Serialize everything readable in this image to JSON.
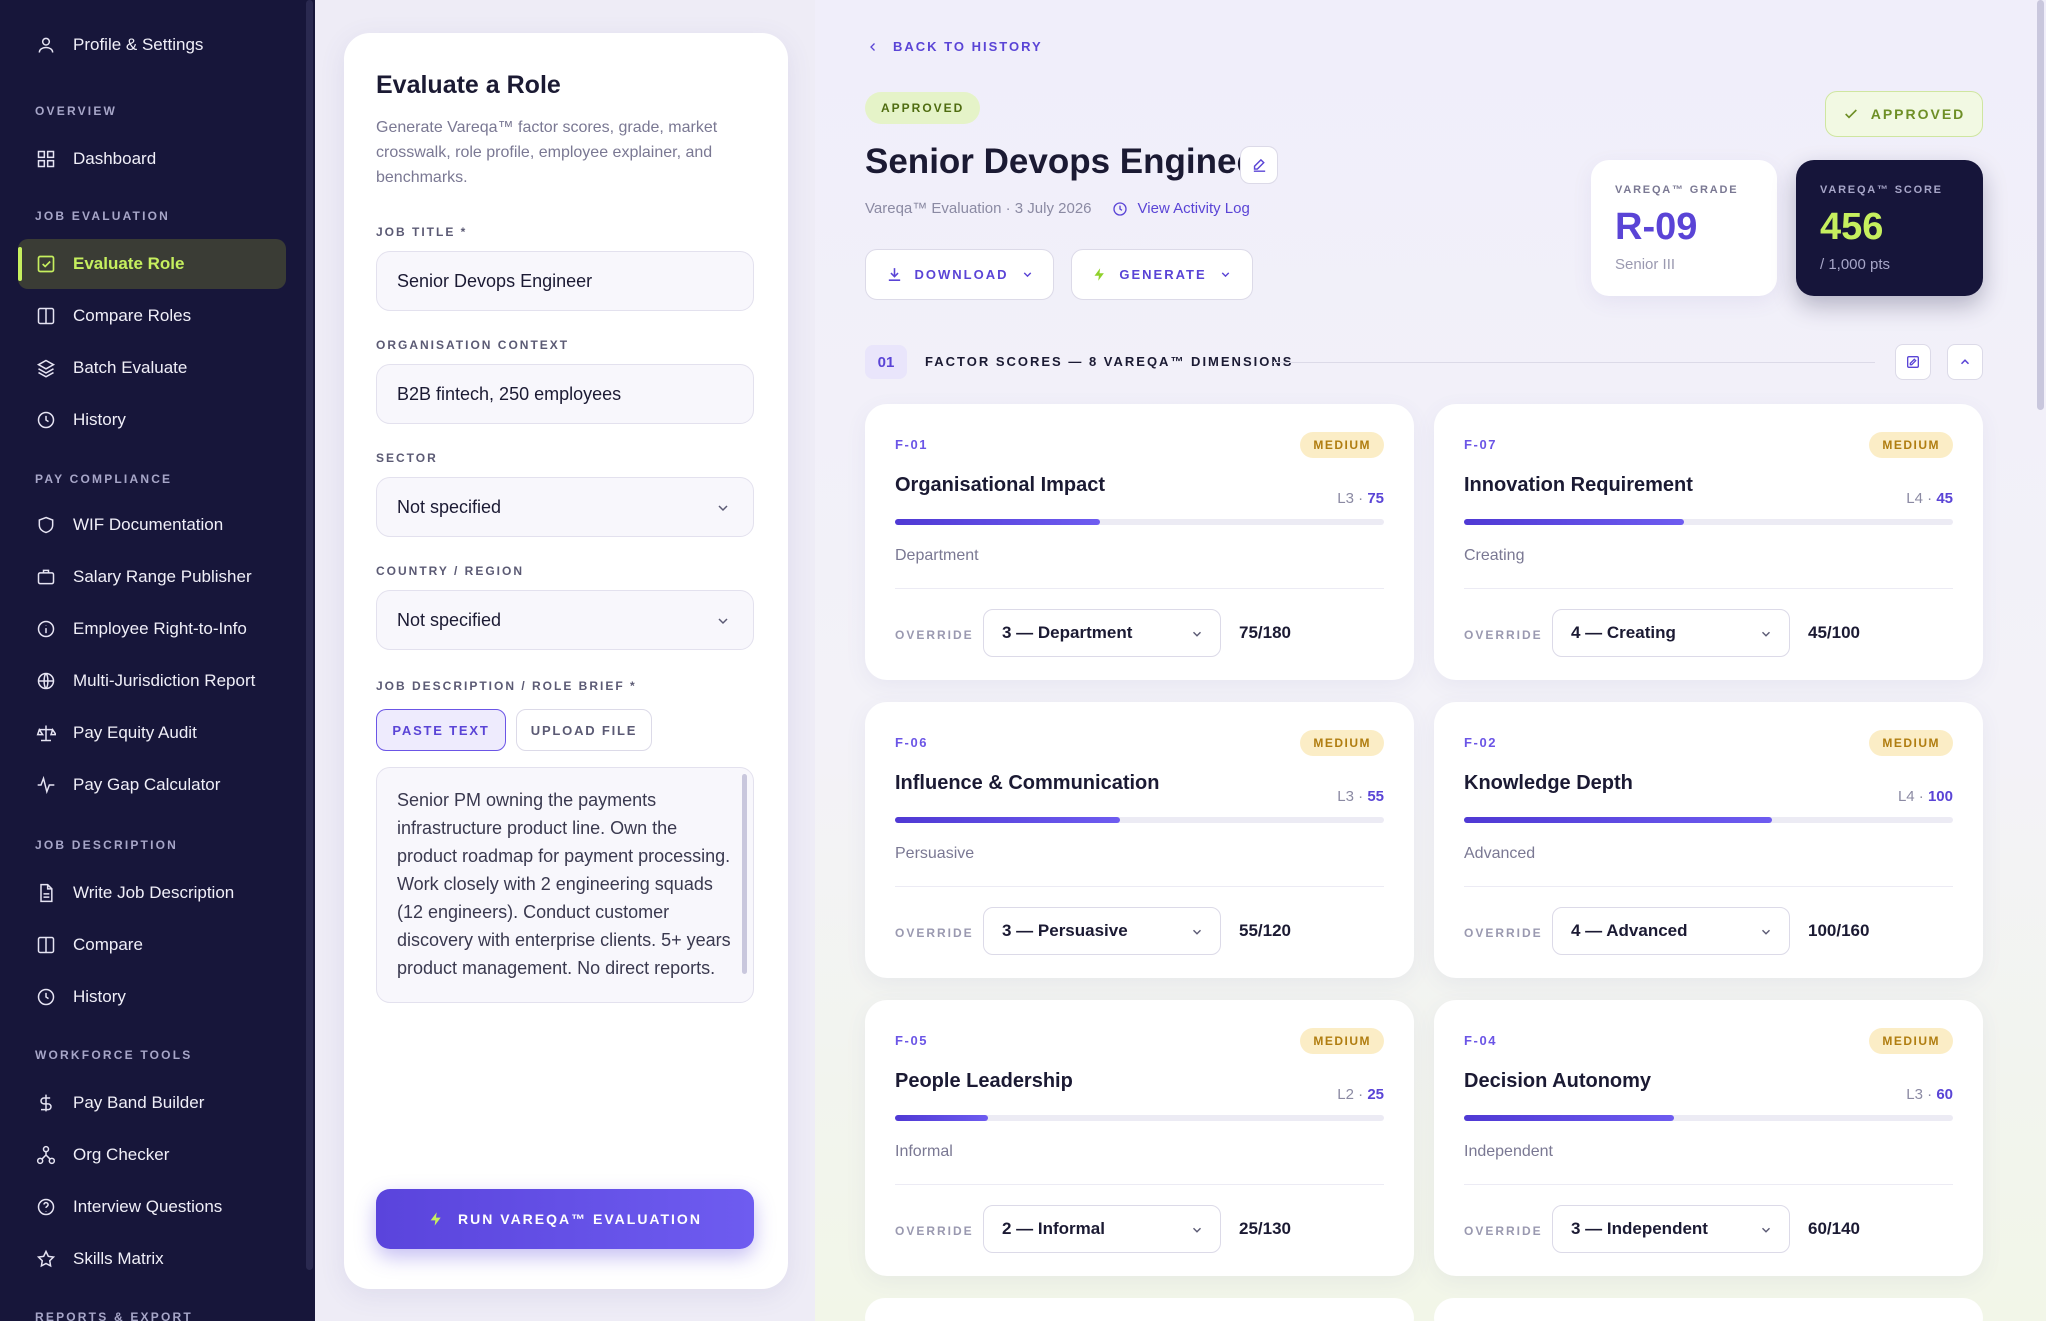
{
  "sidebar": {
    "profile": "Profile & Settings",
    "sections": [
      "OVERVIEW",
      "JOB EVALUATION",
      "PAY COMPLIANCE",
      "JOB DESCRIPTION",
      "WORKFORCE TOOLS",
      "REPORTS & EXPORT"
    ],
    "items": [
      {
        "label": "Dashboard",
        "icon": "dashboard-icon"
      },
      {
        "label": "Evaluate Role",
        "icon": "check-square-icon",
        "active": true
      },
      {
        "label": "Compare Roles",
        "icon": "columns-icon"
      },
      {
        "label": "Batch Evaluate",
        "icon": "layers-icon"
      },
      {
        "label": "History",
        "icon": "clock-icon"
      },
      {
        "label": "WIF Documentation",
        "icon": "shield-icon"
      },
      {
        "label": "Salary Range Publisher",
        "icon": "briefcase-icon"
      },
      {
        "label": "Employee Right-to-Info",
        "icon": "info-icon"
      },
      {
        "label": "Multi-Jurisdiction Report",
        "icon": "globe-icon"
      },
      {
        "label": "Pay Equity Audit",
        "icon": "scale-icon"
      },
      {
        "label": "Pay Gap Calculator",
        "icon": "activity-icon"
      },
      {
        "label": "Write Job Description",
        "icon": "file-text-icon"
      },
      {
        "label": "Compare",
        "icon": "columns-icon"
      },
      {
        "label": "History",
        "icon": "clock-icon"
      },
      {
        "label": "Pay Band Builder",
        "icon": "dollar-icon"
      },
      {
        "label": "Org Checker",
        "icon": "org-chart-icon"
      },
      {
        "label": "Interview Questions",
        "icon": "help-circle-icon"
      },
      {
        "label": "Skills Matrix",
        "icon": "star-icon"
      }
    ]
  },
  "form": {
    "title": "Evaluate a Role",
    "description": "Generate Vareqa™ factor scores, grade, market crosswalk, role profile, employee explainer, and benchmarks.",
    "job_title_label": "JOB TITLE *",
    "job_title_value": "Senior Devops Engineer",
    "org_label": "ORGANISATION CONTEXT",
    "org_value": "B2B fintech, 250 employees",
    "sector_label": "SECTOR",
    "sector_value": "Not specified",
    "country_label": "COUNTRY / REGION",
    "country_value": "Not specified",
    "brief_label": "JOB DESCRIPTION / ROLE BRIEF *",
    "tab_paste": "PASTE TEXT",
    "tab_upload": "UPLOAD FILE",
    "brief_text": "Senior PM owning the payments infrastructure product line. Own the product roadmap for payment processing. Work closely with 2 engineering squads (12 engineers). Conduct customer discovery with enterprise clients. 5+ years product management. No direct reports.",
    "run_button": "RUN VAREQA™ EVALUATION"
  },
  "main": {
    "back": "BACK TO HISTORY",
    "status": "APPROVED",
    "approved_button": "APPROVED",
    "role_title": "Senior Devops Engineer",
    "meta": "Vareqa™ Evaluation · 3 July 2026",
    "activity_link": "View Activity Log",
    "download": "DOWNLOAD",
    "generate": "GENERATE",
    "grade": {
      "label": "VAREQA™ GRADE",
      "value": "R-09",
      "sub": "Senior III"
    },
    "score": {
      "label": "VAREQA™ SCORE",
      "value": "456",
      "sub": "/ 1,000 pts"
    },
    "section_num": "01",
    "section_title": "FACTOR SCORES — 8 VAREQA™ DIMENSIONS",
    "override_label": "OVERRIDE",
    "colors": {
      "accent": "#5a44d6",
      "lime": "#c6ef5e",
      "navy": "#17163a"
    },
    "factors": [
      {
        "code": "F-01",
        "badge": "MEDIUM",
        "name": "Organisational Impact",
        "level": "L3",
        "points": "75",
        "fill": 0.42,
        "desc": "Department",
        "override": "3 — Department",
        "score": "75/180"
      },
      {
        "code": "F-07",
        "badge": "MEDIUM",
        "name": "Innovation Requirement",
        "level": "L4",
        "points": "45",
        "fill": 0.45,
        "desc": "Creating",
        "override": "4 — Creating",
        "score": "45/100"
      },
      {
        "code": "F-06",
        "badge": "MEDIUM",
        "name": "Influence & Communication",
        "level": "L3",
        "points": "55",
        "fill": 0.46,
        "desc": "Persuasive",
        "override": "3 — Persuasive",
        "score": "55/120"
      },
      {
        "code": "F-02",
        "badge": "MEDIUM",
        "name": "Knowledge Depth",
        "level": "L4",
        "points": "100",
        "fill": 0.63,
        "desc": "Advanced",
        "override": "4 — Advanced",
        "score": "100/160"
      },
      {
        "code": "F-05",
        "badge": "MEDIUM",
        "name": "People Leadership",
        "level": "L2",
        "points": "25",
        "fill": 0.19,
        "desc": "Informal",
        "override": "2 — Informal",
        "score": "25/130"
      },
      {
        "code": "F-04",
        "badge": "MEDIUM",
        "name": "Decision Autonomy",
        "level": "L3",
        "points": "60",
        "fill": 0.43,
        "desc": "Independent",
        "override": "3 — Independent",
        "score": "60/140"
      }
    ]
  }
}
